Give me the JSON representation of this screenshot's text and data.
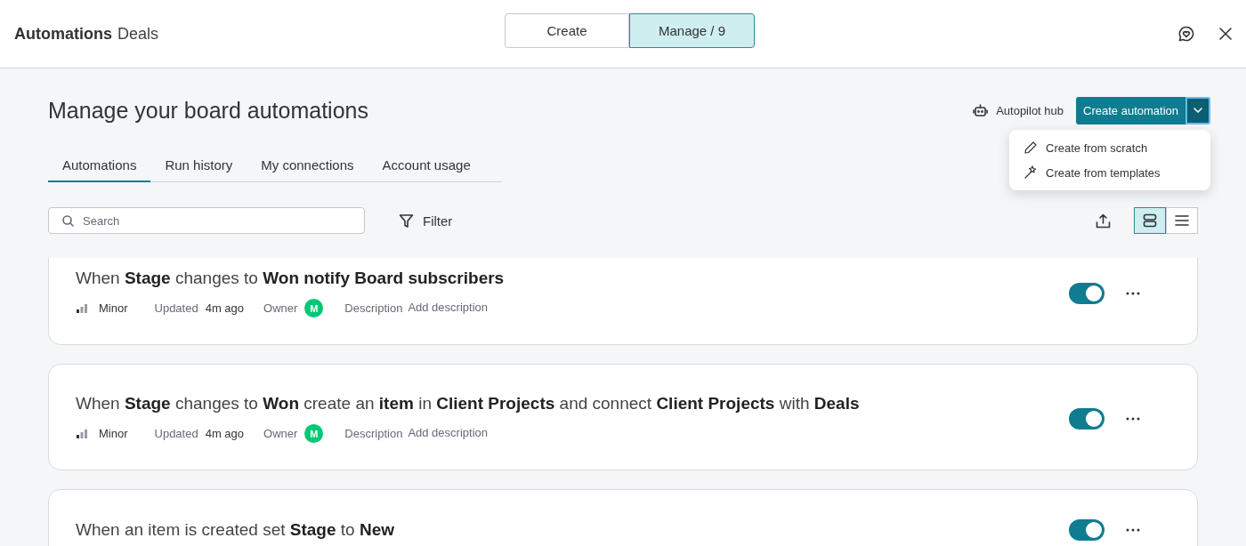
{
  "header": {
    "title": "Automations",
    "board": "Deals",
    "modes": [
      {
        "label": "Create",
        "selected": false
      },
      {
        "label": "Manage / 9",
        "selected": true
      }
    ]
  },
  "page_title": "Manage your board automations",
  "autopilot_hub": "Autopilot hub",
  "create_button": "Create automation",
  "create_menu": {
    "open": true,
    "items": [
      {
        "kind": "pencil",
        "label": "Create from scratch"
      },
      {
        "kind": "wand",
        "label": "Create from templates"
      }
    ]
  },
  "tabs": [
    {
      "label": "Automations",
      "selected": true
    },
    {
      "label": "Run history",
      "selected": false
    },
    {
      "label": "My connections",
      "selected": false
    },
    {
      "label": "Account usage",
      "selected": false
    }
  ],
  "search": {
    "placeholder": "Search"
  },
  "filter": "Filter",
  "view_modes": [
    {
      "kind": "cards",
      "selected": true
    },
    {
      "kind": "list",
      "selected": false
    }
  ],
  "automations": [
    {
      "title": "When **Stage** changes to **Won notify Board subscribers**",
      "on": true,
      "priority": "Minor",
      "updated_label": "Updated",
      "updated": "4m ago",
      "owner_label": "Owner",
      "owner_initial": "M",
      "description_label": "Description",
      "description": "Add description"
    },
    {
      "title": "When **Stage** changes to **Won** create an **item** in **Client Projects** and connect **Client Projects** with **Deals**",
      "on": true,
      "priority": "Minor",
      "updated_label": "Updated",
      "updated": "4m ago",
      "owner_label": "Owner",
      "owner_initial": "M",
      "description_label": "Description",
      "description": "Add description"
    },
    {
      "title": "When an item is created set **Stage** to **New**",
      "on": true
    }
  ]
}
